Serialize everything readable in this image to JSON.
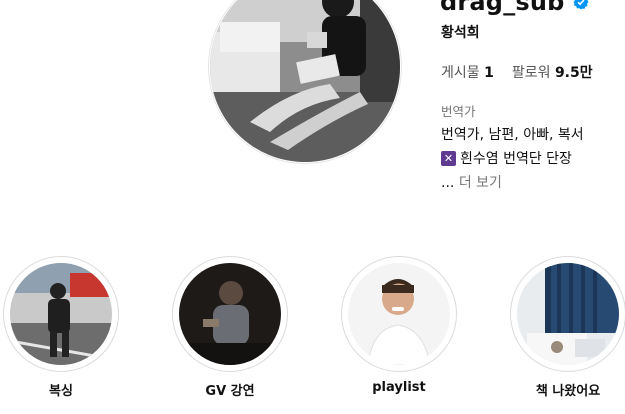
{
  "profile": {
    "username": "drag_sub",
    "verified_icon": "verified-badge-icon",
    "full_name": "황석희",
    "stats": {
      "posts_label": "게시물",
      "posts_count": "1",
      "followers_label": "팔로워",
      "followers_count": "9.5만"
    },
    "category": "번역가",
    "bio_line1": "번역가, 남편, 아빠, 복서",
    "bio_line2_icon": "x-square-icon",
    "bio_line2": "흰수염 번역단 단장",
    "more_dots": "...",
    "more_label": "더 보기"
  },
  "highlights": [
    {
      "label": "복싱"
    },
    {
      "label": "GV 강연"
    },
    {
      "label": "playlist"
    },
    {
      "label": "책 나왔어요"
    }
  ],
  "colors": {
    "verified": "#0095f6",
    "secondary_text": "#737373",
    "ring": "#dbdbdb"
  }
}
